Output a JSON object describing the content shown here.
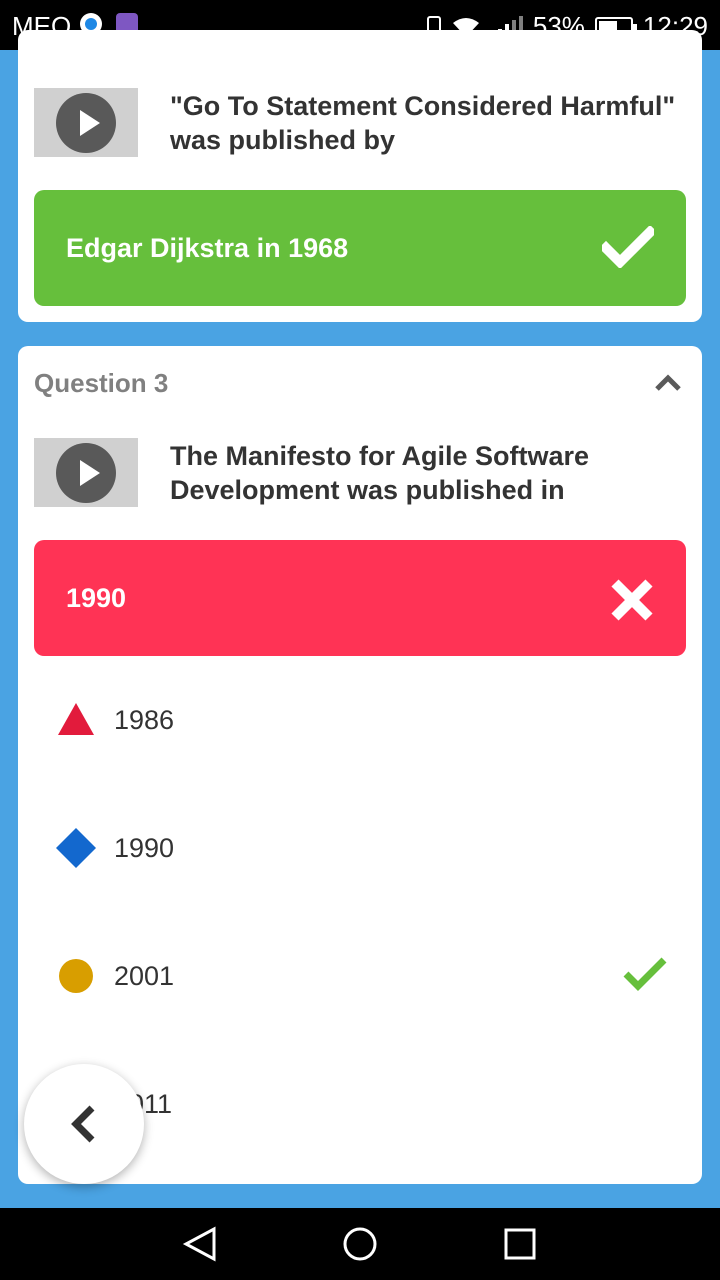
{
  "status_bar": {
    "carrier": "MEO",
    "battery": "53%",
    "time": "12:29"
  },
  "question2": {
    "text": "\"Go To Statement Considered Harmful\" was published by",
    "selected_answer": "Edgar Dijkstra in 1968",
    "selected_status": "correct"
  },
  "question3": {
    "header": "Question 3",
    "text": "The Manifesto for Agile Software Development was published in",
    "selected_answer": "1990",
    "selected_status": "wrong",
    "options": [
      {
        "label": "1986",
        "shape": "triangle",
        "color": "#e21b3c",
        "correct": false
      },
      {
        "label": "1990",
        "shape": "diamond",
        "color": "#1368ce",
        "correct": false
      },
      {
        "label": "2001",
        "shape": "circle",
        "color": "#d89e00",
        "correct": true
      },
      {
        "label": "2011",
        "shape": "square",
        "color": "#26890c",
        "correct": false
      }
    ]
  },
  "colors": {
    "background": "#4aa3e3",
    "correct": "#66bf3c",
    "wrong": "#ff3355"
  }
}
